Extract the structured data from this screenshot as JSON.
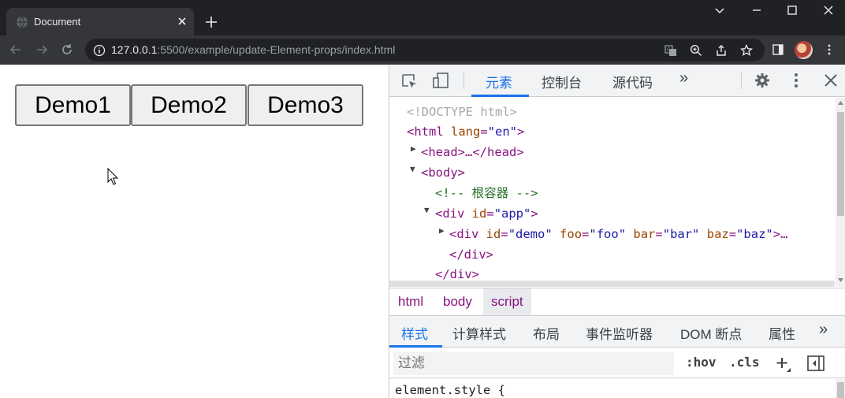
{
  "browser": {
    "tab_title": "Document",
    "url_host": "127.0.0.1",
    "url_rest": ":5500/example/update-Element-props/index.html"
  },
  "page": {
    "buttons": [
      "Demo1",
      "Demo2",
      "Demo3"
    ]
  },
  "devtools": {
    "tabs": [
      "元素",
      "控制台",
      "源代码"
    ],
    "active_tab": "元素",
    "more_tabs": "»",
    "dom": {
      "doctype": "<!DOCTYPE html>",
      "html_open": "<html",
      "html_lang_attr": "lang",
      "html_lang_val": "\"en\"",
      "head": "<head>…</head>",
      "body_open": "<body>",
      "comment": "<!-- 根容器 -->",
      "div_app_open": "<div",
      "div_app_id_attr": "id",
      "div_app_id_val": "\"app\"",
      "div_demo_open": "<div",
      "demo_id_attr": "id",
      "demo_id_val": "\"demo\"",
      "demo_foo_attr": "foo",
      "demo_foo_val": "\"foo\"",
      "demo_bar_attr": "bar",
      "demo_bar_val": "\"bar\"",
      "demo_baz_attr": "baz",
      "demo_baz_val": "\"baz\"",
      "demo_ellipsis": ">…",
      "div_close_1": "</div>",
      "div_close_2": "</div>"
    },
    "breadcrumbs": [
      "html",
      "body",
      "script"
    ],
    "selected_crumb": "script",
    "sub_tabs": [
      "样式",
      "计算样式",
      "布局",
      "事件监听器",
      "DOM 断点",
      "属性"
    ],
    "active_sub_tab": "样式",
    "filter_placeholder": "过滤",
    "hov_label": ":hov",
    "cls_label": ".cls",
    "element_style": "element.style {"
  },
  "colors": {
    "accent": "#1a73e8",
    "tag": "#881280",
    "attr": "#994500",
    "value": "#1a1aa6",
    "comment": "#236e25"
  }
}
